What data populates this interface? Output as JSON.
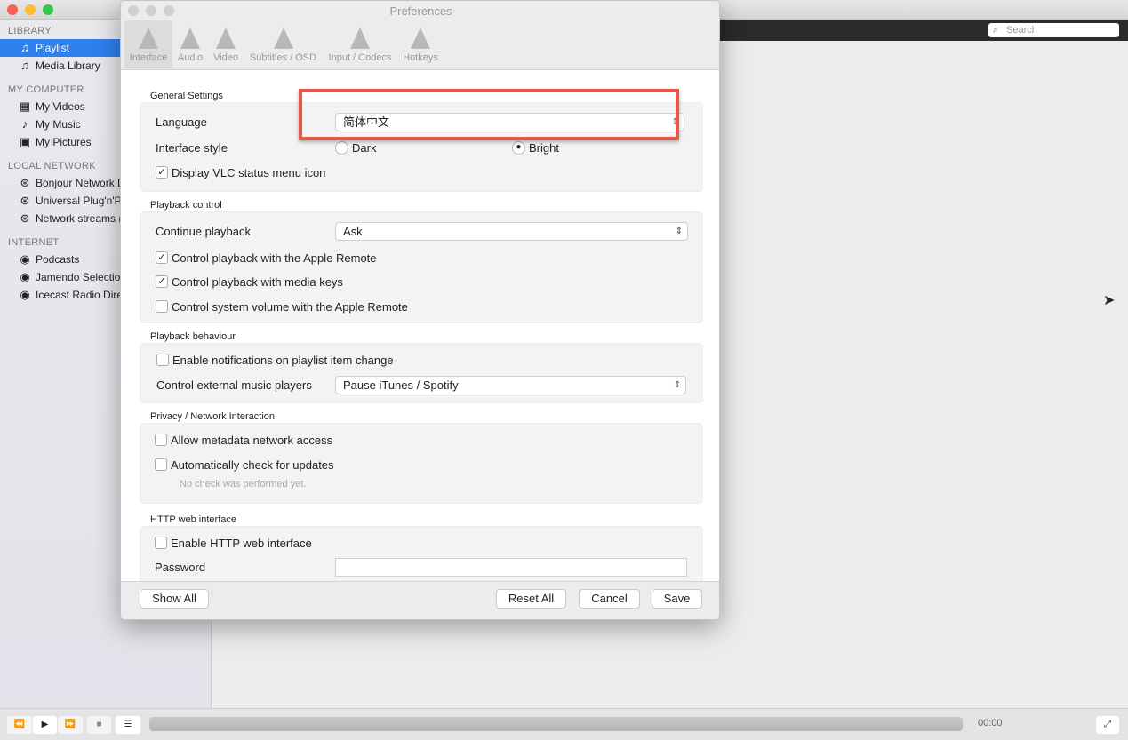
{
  "main": {
    "search_placeholder": "Search",
    "traffic_colors": [
      "#fc5f57",
      "#fdbc2e",
      "#33c748"
    ],
    "sidebar": {
      "sections": [
        {
          "title": "LIBRARY",
          "items": [
            {
              "label": "Playlist",
              "icon": "playlist-icon",
              "selected": true
            },
            {
              "label": "Media Library",
              "icon": "media-library-icon"
            }
          ]
        },
        {
          "title": "MY COMPUTER",
          "items": [
            {
              "label": "My Videos",
              "icon": "film-icon"
            },
            {
              "label": "My Music",
              "icon": "music-note-icon"
            },
            {
              "label": "My Pictures",
              "icon": "picture-icon"
            }
          ]
        },
        {
          "title": "LOCAL NETWORK",
          "items": [
            {
              "label": "Bonjour Network D",
              "icon": "network-icon"
            },
            {
              "label": "Universal Plug'n'P",
              "icon": "network-icon"
            },
            {
              "label": "Network streams (",
              "icon": "network-icon"
            }
          ]
        },
        {
          "title": "INTERNET",
          "items": [
            {
              "label": "Podcasts",
              "icon": "podcast-icon"
            },
            {
              "label": "Jamendo Selection",
              "icon": "podcast-icon"
            },
            {
              "label": "Icecast Radio Dire",
              "icon": "podcast-icon"
            }
          ]
        }
      ]
    },
    "player": {
      "time": "00:00",
      "icons": {
        "rewind": "⏪",
        "play": "▶",
        "forward": "⏩",
        "stop": "■",
        "playlist": "☰",
        "fullscreen": "⤢"
      }
    }
  },
  "prefs": {
    "title": "Preferences",
    "tabs": [
      {
        "label": "Interface",
        "selected": true
      },
      {
        "label": "Audio"
      },
      {
        "label": "Video"
      },
      {
        "label": "Subtitles / OSD"
      },
      {
        "label": "Input / Codecs"
      },
      {
        "label": "Hotkeys"
      }
    ],
    "general": {
      "title": "General Settings",
      "language_label": "Language",
      "language_value": "简体中文",
      "style_label": "Interface style",
      "style_dark": "Dark",
      "style_bright": "Bright",
      "style_selected": "Bright",
      "status_icon": "Display VLC status menu icon",
      "status_icon_checked": true
    },
    "playback": {
      "title": "Playback control",
      "continue_label": "Continue playback",
      "continue_value": "Ask",
      "apple_remote": "Control playback with the Apple Remote",
      "apple_remote_checked": true,
      "media_keys": "Control playback with media keys",
      "media_keys_checked": true,
      "system_volume": "Control system volume with the Apple Remote",
      "system_volume_checked": false
    },
    "behaviour": {
      "title": "Playback behaviour",
      "notifications": "Enable notifications on playlist item change",
      "notifications_checked": false,
      "external_label": "Control external music players",
      "external_value": "Pause iTunes / Spotify"
    },
    "privacy": {
      "title": "Privacy / Network Interaction",
      "metadata": "Allow metadata network access",
      "metadata_checked": false,
      "updates": "Automatically check for updates",
      "updates_checked": false,
      "updates_note": "No check was performed yet."
    },
    "http": {
      "title": "HTTP web interface",
      "enable": "Enable HTTP web interface",
      "enable_checked": false,
      "password_label": "Password",
      "password_value": ""
    },
    "buttons": {
      "show_all": "Show All",
      "reset_all": "Reset All",
      "cancel": "Cancel",
      "save": "Save"
    },
    "highlight_color": "#e8574a"
  }
}
